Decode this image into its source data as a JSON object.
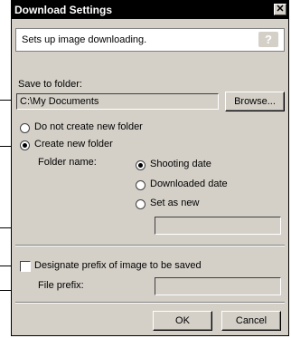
{
  "window": {
    "title": "Download Settings",
    "close_glyph": "✕"
  },
  "description": {
    "text": "Sets up image downloading.",
    "help_label": "?"
  },
  "save_to": {
    "label": "Save to folder:",
    "value": "C:\\My Documents",
    "browse_label": "Browse..."
  },
  "folder_options": {
    "do_not_create": "Do not create new folder",
    "create_new": "Create new folder",
    "selected": "create_new"
  },
  "folder_name": {
    "label": "Folder name:",
    "options": [
      "Shooting date",
      "Downloaded date",
      "Set as new"
    ],
    "selected_index": 0,
    "new_name_value": ""
  },
  "prefix": {
    "checkbox_label": "Designate prefix of image to be saved",
    "checked": false,
    "field_label": "File prefix:",
    "value": ""
  },
  "buttons": {
    "ok": "OK",
    "cancel": "Cancel"
  }
}
